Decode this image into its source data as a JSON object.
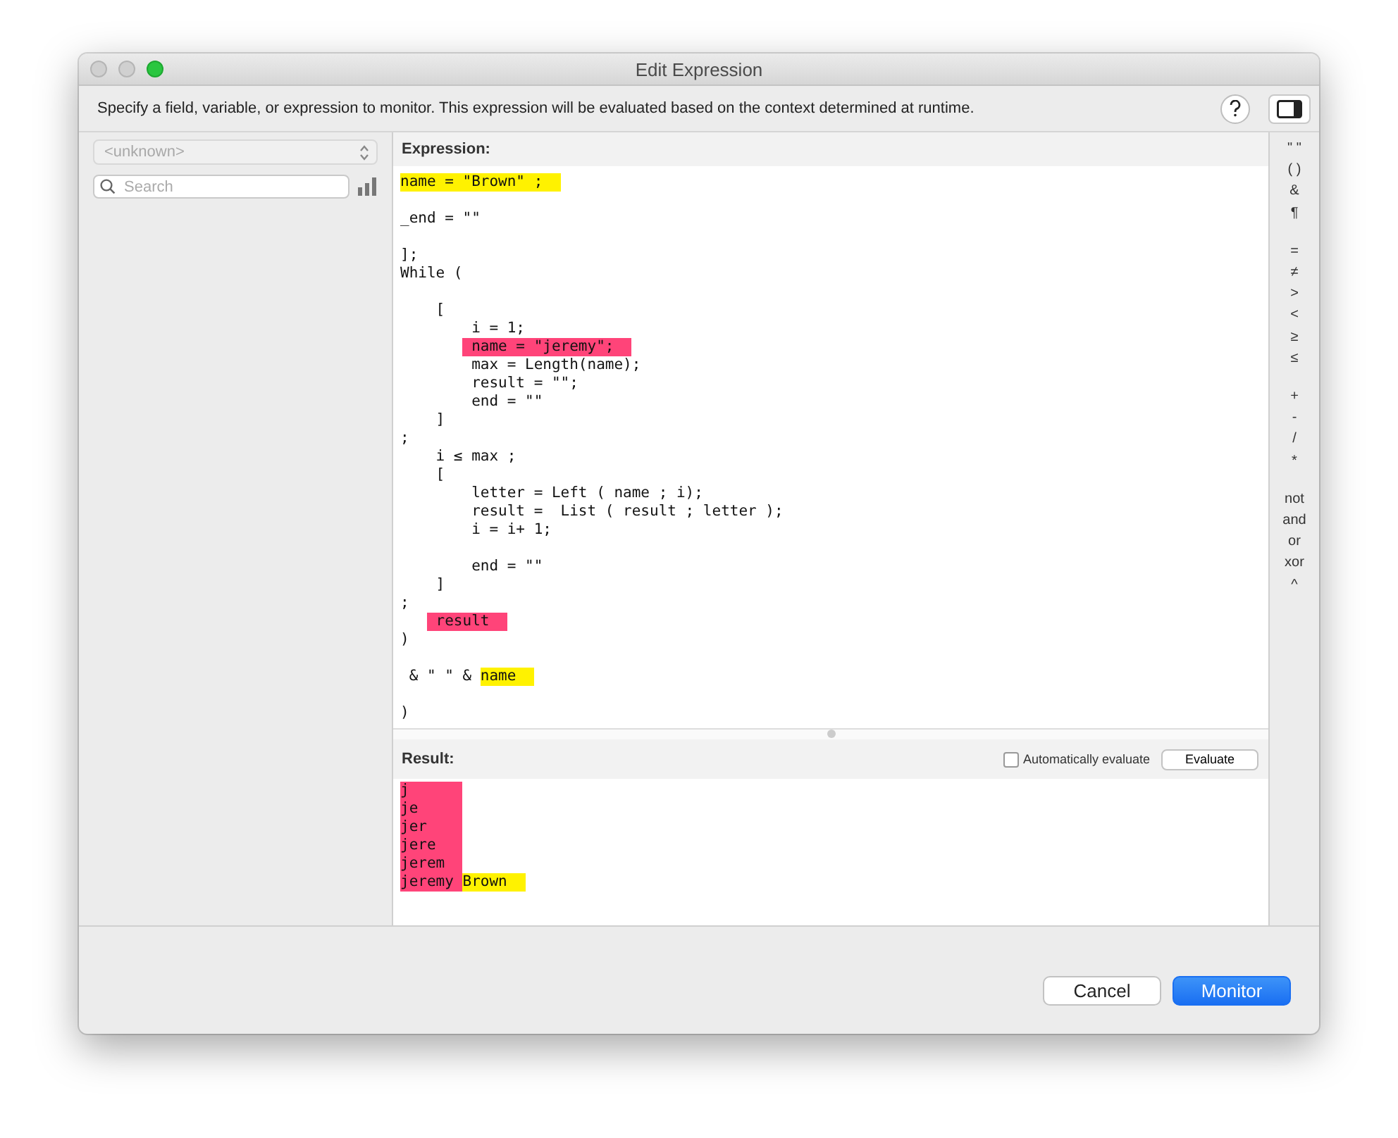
{
  "window": {
    "title": "Edit Expression"
  },
  "description": "Specify a field, variable, or expression to monitor. This expression will be evaluated based on the context determined at runtime.",
  "sidebar": {
    "context_select": {
      "value": "<unknown>",
      "disabled": true
    },
    "search": {
      "placeholder": "Search"
    }
  },
  "expression": {
    "label": "Expression:",
    "lines": [
      {
        "segments": [
          {
            "text": "name = \"Brown\" ;",
            "color": "#fff200"
          }
        ],
        "blank_after": true
      },
      {
        "segments": [
          {
            "text": "_end = \"\""
          }
        ],
        "blank_after": true
      },
      {
        "segments": [
          {
            "text": "];"
          }
        ]
      },
      {
        "segments": [
          {
            "text": "While ("
          }
        ],
        "blank_after": true
      },
      {
        "segments": [
          {
            "text": "    ["
          }
        ]
      },
      {
        "segments": [
          {
            "text": "        i = 1;"
          }
        ]
      },
      {
        "segments": [
          {
            "text": "        name = \"jeremy\";",
            "color": "#ff4479"
          }
        ]
      },
      {
        "segments": [
          {
            "text": "        max = Length(name);"
          }
        ]
      },
      {
        "segments": [
          {
            "text": "        result = \"\";"
          }
        ]
      },
      {
        "segments": [
          {
            "text": "        end = \"\""
          }
        ]
      },
      {
        "segments": [
          {
            "text": "    ]"
          }
        ]
      },
      {
        "segments": [
          {
            "text": ";"
          }
        ]
      },
      {
        "segments": [
          {
            "text": "    i ≤ max ;"
          }
        ]
      },
      {
        "segments": [
          {
            "text": "    ["
          }
        ]
      },
      {
        "segments": [
          {
            "text": "        letter = Left ( name ; i);"
          }
        ]
      },
      {
        "segments": [
          {
            "text": "        result =  List ( result ; letter );"
          }
        ]
      },
      {
        "segments": [
          {
            "text": "        i = i+ 1;"
          }
        ],
        "blank_after": true
      },
      {
        "segments": [
          {
            "text": "        end = \"\""
          }
        ]
      },
      {
        "segments": [
          {
            "text": "    ]"
          }
        ]
      },
      {
        "segments": [
          {
            "text": ";"
          }
        ]
      },
      {
        "segments": [
          {
            "text": "    result",
            "color": "#ff4479"
          }
        ]
      },
      {
        "segments": [
          {
            "text": ")"
          }
        ],
        "blank_after": true
      },
      {
        "segments": [
          {
            "text": " & \" \" & "
          },
          {
            "text": "name",
            "color": "#fff200"
          }
        ],
        "blank_after": true
      },
      {
        "segments": [
          {
            "text": ")"
          }
        ]
      }
    ]
  },
  "result": {
    "label": "Result:",
    "auto_evaluate": {
      "label": "Automatically evaluate",
      "checked": false
    },
    "evaluate_button": "Evaluate",
    "lines": [
      {
        "segments": [
          {
            "text": "j",
            "color": "#ff4479"
          }
        ]
      },
      {
        "segments": [
          {
            "text": "je",
            "color": "#ff4479"
          }
        ]
      },
      {
        "segments": [
          {
            "text": "jer",
            "color": "#ff4479"
          }
        ]
      },
      {
        "segments": [
          {
            "text": "jere",
            "color": "#ff4479"
          }
        ]
      },
      {
        "segments": [
          {
            "text": "jerem",
            "color": "#ff4479"
          }
        ]
      },
      {
        "segments": [
          {
            "text": "jeremy ",
            "color": "#ff4479"
          },
          {
            "text": "Brown",
            "color": "#fff200"
          }
        ]
      }
    ]
  },
  "operators": [
    [
      "\" \"",
      "( )",
      "&",
      "¶"
    ],
    [
      "=",
      "≠",
      ">",
      "<",
      "≥",
      "≤"
    ],
    [
      "+",
      "-",
      "/",
      "*"
    ],
    [
      "not",
      "and",
      "or",
      "xor",
      "^"
    ]
  ],
  "buttons": [
    {
      "label": "Cancel",
      "default": false
    },
    {
      "label": "Monitor",
      "default": true
    }
  ]
}
